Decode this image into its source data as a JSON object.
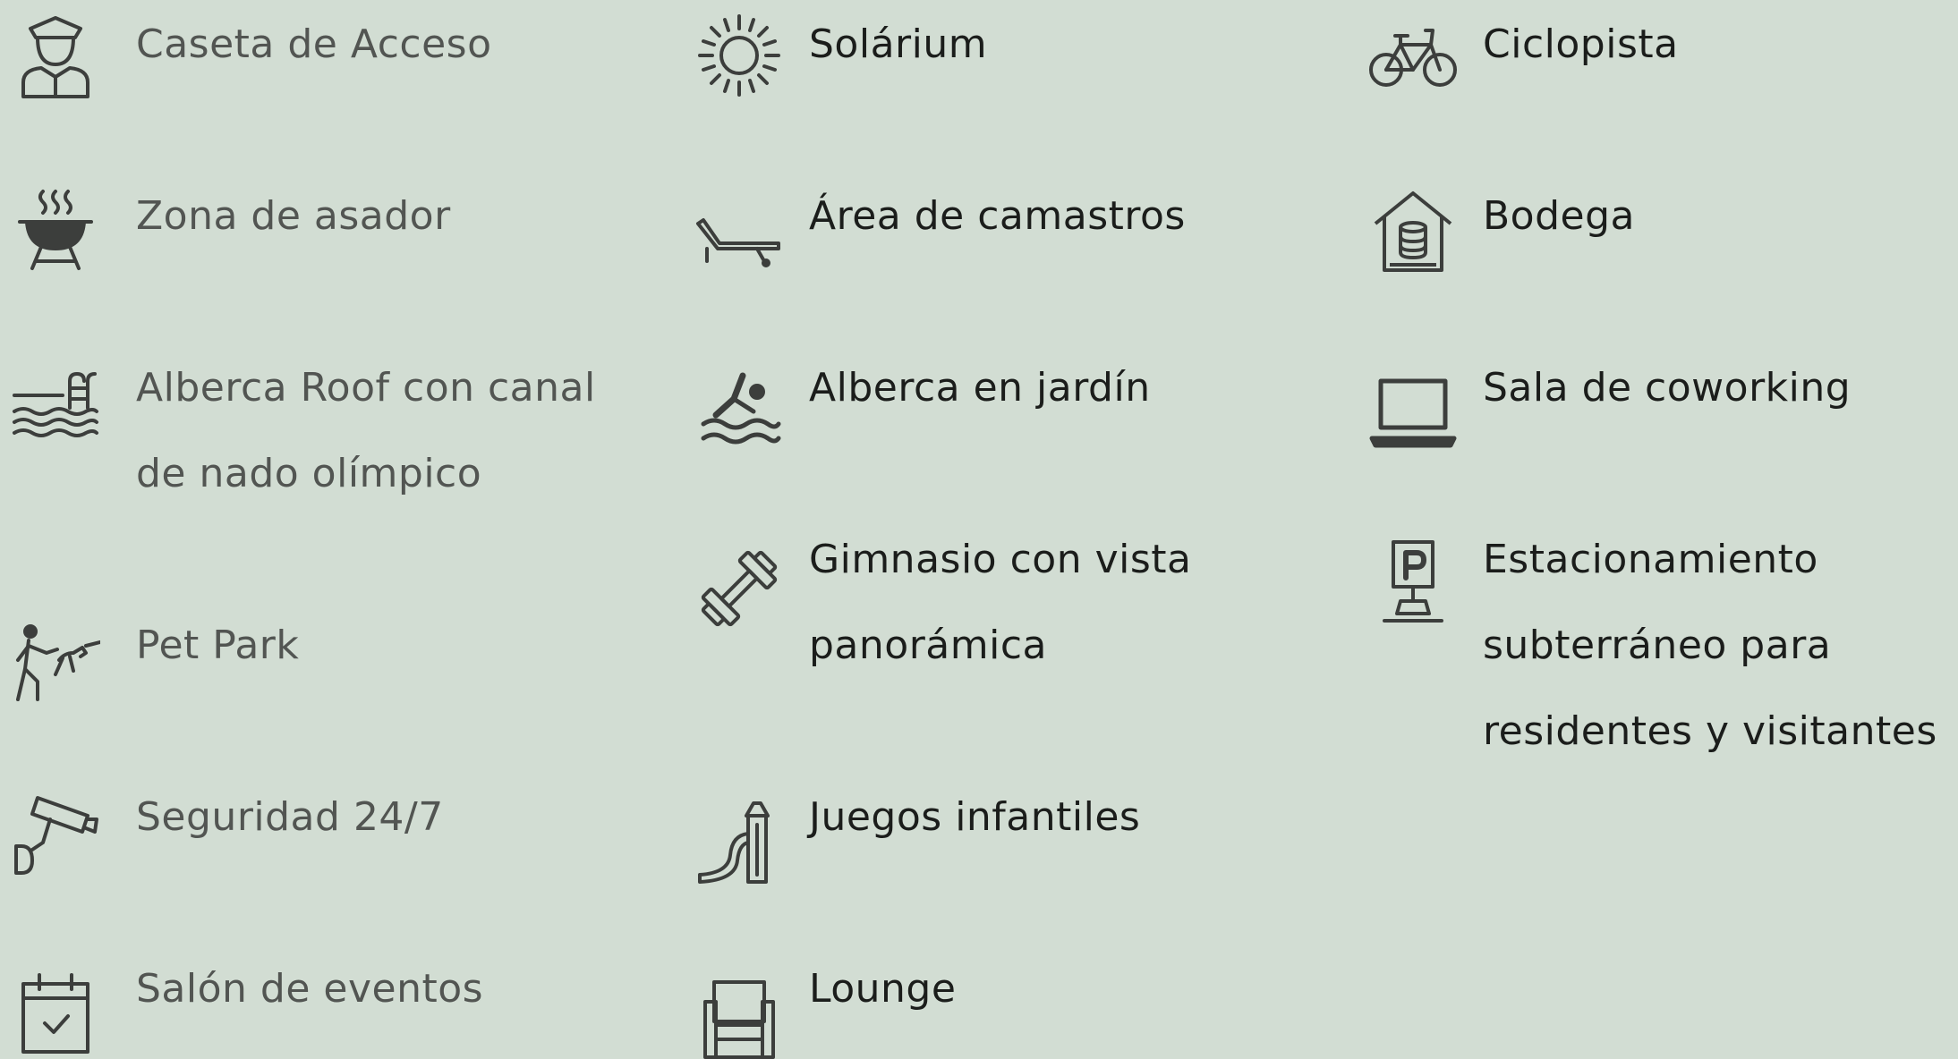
{
  "columns": [
    {
      "items": [
        {
          "label": "Caseta de Acceso",
          "icon": "guard-icon"
        },
        {
          "label": "Zona de asador",
          "icon": "grill-icon"
        },
        {
          "label": "Alberca Roof con canal de nado olímpico",
          "icon": "pool-ladder-icon"
        },
        {
          "label": "Pet Park",
          "icon": "pet-park-icon"
        },
        {
          "label": "Seguridad 24/7",
          "icon": "security-camera-icon"
        },
        {
          "label": "Salón de eventos",
          "icon": "calendar-check-icon"
        }
      ]
    },
    {
      "items": [
        {
          "label": "Solárium",
          "icon": "sun-icon"
        },
        {
          "label": "Área de camastros",
          "icon": "sunbed-icon"
        },
        {
          "label": "Alberca en jardín",
          "icon": "swimmer-icon"
        },
        {
          "label": "Gimnasio con vista panorámica",
          "icon": "dumbbell-icon"
        },
        {
          "label": "Juegos infantiles",
          "icon": "playground-slide-icon"
        },
        {
          "label": "Lounge",
          "icon": "armchair-icon"
        }
      ]
    },
    {
      "items": [
        {
          "label": "Ciclopista",
          "icon": "bicycle-icon"
        },
        {
          "label": "Bodega",
          "icon": "storage-house-icon"
        },
        {
          "label": "Sala de coworking",
          "icon": "laptop-icon"
        },
        {
          "label": "Estacionamiento subterráneo para residentes y visitantes",
          "icon": "parking-sign-icon"
        }
      ]
    }
  ],
  "colors": {
    "background": "#d2ddd3",
    "col0_text": "#525552",
    "text": "#1b1d1b",
    "icon": "#3c3e3c"
  }
}
